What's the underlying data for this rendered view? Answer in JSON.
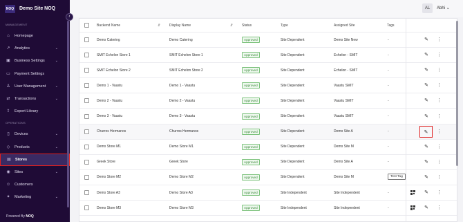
{
  "brand": {
    "logo": "NOQ",
    "name": "Demo Site NOQ"
  },
  "sidebar": {
    "management_label": "MANAGEMENT",
    "operations_label": "OPERATIONS",
    "management_items": [
      {
        "label": "Homepage",
        "icon": "home-icon",
        "chevron": false
      },
      {
        "label": "Analytics",
        "icon": "chart-icon",
        "chevron": true
      },
      {
        "label": "Business Settings",
        "icon": "briefcase-icon",
        "chevron": true
      },
      {
        "label": "Payment Settings",
        "icon": "card-icon",
        "chevron": false
      },
      {
        "label": "User Management",
        "icon": "user-icon",
        "chevron": true
      },
      {
        "label": "Transactions",
        "icon": "transactions-icon",
        "chevron": true
      },
      {
        "label": "Export Library",
        "icon": "export-icon",
        "chevron": false
      }
    ],
    "operations_items": [
      {
        "label": "Devices",
        "icon": "device-icon",
        "chevron": true
      },
      {
        "label": "Products",
        "icon": "tag-icon",
        "chevron": true
      },
      {
        "label": "Stores",
        "icon": "store-icon",
        "chevron": false,
        "active": true
      },
      {
        "label": "Sites",
        "icon": "site-icon",
        "chevron": true
      },
      {
        "label": "Customers",
        "icon": "customers-icon",
        "chevron": false
      },
      {
        "label": "Marketing",
        "icon": "marketing-icon",
        "chevron": true
      }
    ],
    "powered_by": "Powered By",
    "powered_brand": "NOQ"
  },
  "topbar": {
    "avatar": "AL",
    "user": "Abhi"
  },
  "table": {
    "headers": {
      "backend": "Backend Name",
      "display": "Display Name",
      "status": "Status",
      "type": "Type",
      "site": "Assigned Site",
      "tags": "Tags"
    },
    "rows": [
      {
        "backend": "Demo Catering",
        "display": "Demo Catering",
        "status": "Approved",
        "type": "Site Dependent",
        "site": "Demo Site New",
        "tags": "-"
      },
      {
        "backend": "SMIT Echelon Store 1",
        "display": "SMIT Echelon Store 1",
        "status": "Approved",
        "type": "Site Dependent",
        "site": "Echelon - SMIT",
        "tags": "-"
      },
      {
        "backend": "SMIT Echelon Store 2",
        "display": "SMIT Echelon Store 2",
        "status": "Approved",
        "type": "Site Dependent",
        "site": "Echelon - SMIT",
        "tags": "-"
      },
      {
        "backend": "Demo 1 - Vaastu",
        "display": "Demo 1 - Vaastu",
        "status": "Approved",
        "type": "Site Dependent",
        "site": "Vaastu SMIT",
        "tags": "-"
      },
      {
        "backend": "Demo 2 - Vaastu",
        "display": "Demo 2 - Vaastu",
        "status": "Approved",
        "type": "Site Dependent",
        "site": "Vaastu SMIT",
        "tags": "-"
      },
      {
        "backend": "Demo 3 - Vaastu",
        "display": "Demo 3 - Vaastu",
        "status": "Approved",
        "type": "Site Dependent",
        "site": "Vaastu SMIT",
        "tags": "-"
      },
      {
        "backend": "Churros Hermanos",
        "display": "Churros Hermanos",
        "status": "Approved",
        "type": "Site Dependent",
        "site": "Demo Site A",
        "tags": "-"
      },
      {
        "backend": "Demo Store M1",
        "display": "Demo Store M1",
        "status": "Approved",
        "type": "Site Dependent",
        "site": "Demo Site M",
        "tags": "-"
      },
      {
        "backend": "Greek Store",
        "display": "Greek Store",
        "status": "Approved",
        "type": "Site Dependent",
        "site": "Demo Site A",
        "tags": "-"
      },
      {
        "backend": "Demo Store M2",
        "display": "Demo Store M2",
        "status": "Approved",
        "type": "Site Dependent",
        "site": "Demo Site M",
        "tags": "Test Tag"
      },
      {
        "backend": "Demo Store A3",
        "display": "Demo Store A3",
        "status": "Approved",
        "type": "Site Independent",
        "site": "Site Independent",
        "tags": "-"
      },
      {
        "backend": "Demo Store M3",
        "display": "Demo Store M3",
        "status": "Approved",
        "type": "Site Independent",
        "site": "Site Independent",
        "tags": "-"
      }
    ]
  }
}
